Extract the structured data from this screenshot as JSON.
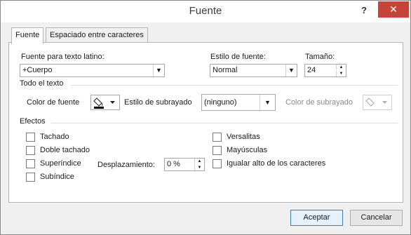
{
  "window": {
    "title": "Fuente",
    "help": "?",
    "close": "✕"
  },
  "tabs": [
    {
      "label": "Fuente",
      "active": true
    },
    {
      "label": "Espaciado entre caracteres",
      "active": false
    }
  ],
  "font": {
    "latin_label": "Fuente para texto latino:",
    "latin_value": "+Cuerpo",
    "style_label": "Estilo de fuente:",
    "style_value": "Normal",
    "size_label": "Tamaño:",
    "size_value": "24"
  },
  "all_text": {
    "section": "Todo el texto",
    "color_label": "Color de fuente",
    "underline_style_label": "Estilo de subrayado",
    "underline_style_value": "(ninguno)",
    "underline_color_label": "Color de subrayado"
  },
  "effects": {
    "section": "Efectos",
    "left": [
      {
        "label": "Tachado",
        "checked": false
      },
      {
        "label": "Doble tachado",
        "checked": false
      },
      {
        "label": "Superíndice",
        "checked": false
      },
      {
        "label": "Subíndice",
        "checked": false
      }
    ],
    "right": [
      {
        "label": "Versalitas",
        "checked": false
      },
      {
        "label": "Mayúsculas",
        "checked": false
      },
      {
        "label": "Igualar alto de los caracteres",
        "checked": false
      }
    ],
    "offset_label": "Desplazamiento:",
    "offset_value": "0 %"
  },
  "buttons": {
    "ok": "Aceptar",
    "cancel": "Cancelar"
  },
  "colors": {
    "accent": "#3c7fb1",
    "close": "#c4443a"
  },
  "icons": [
    "paint-bucket-icon",
    "chevron-down-icon",
    "close-icon"
  ]
}
